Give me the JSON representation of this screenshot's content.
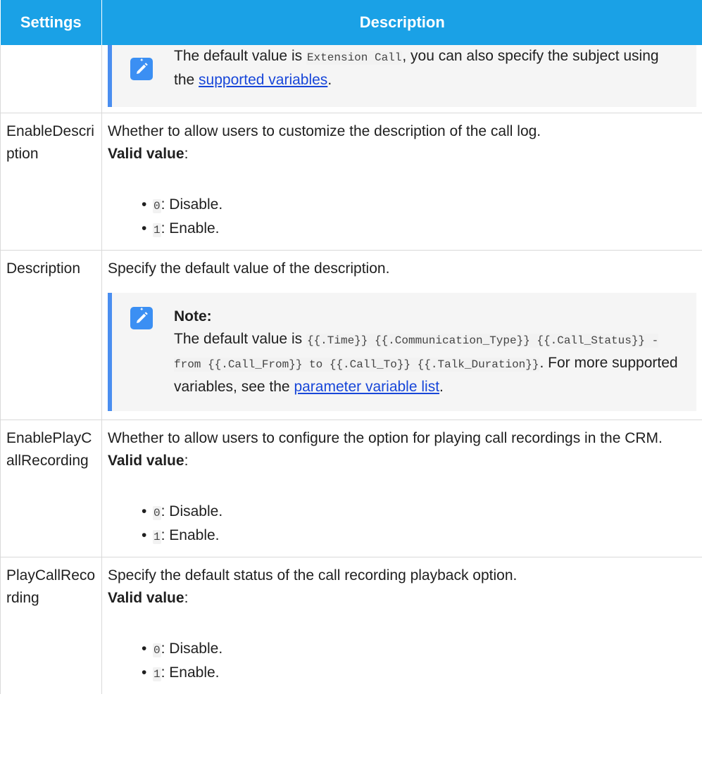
{
  "table": {
    "headers": {
      "settings": "Settings",
      "description": "Description"
    },
    "row0": {
      "note_text_before": "The default value is ",
      "note_code": "Extension Call",
      "note_text_mid": ", you can also specify the subject using the ",
      "note_link": "supported variables",
      "note_text_after": "."
    },
    "row1": {
      "setting": "EnableDescription",
      "desc": "Whether to allow users to customize the description of the call log.",
      "valid_label": "Valid value",
      "valid_colon": ":",
      "items": [
        {
          "code": "0",
          "text": ": Disable."
        },
        {
          "code": "1",
          "text": ": Enable."
        }
      ]
    },
    "row2": {
      "setting": "Description",
      "desc": "Specify the default value of the description.",
      "note_title": "Note:",
      "note_text_before": "The default value is ",
      "note_code": "{{.Time}} {{.Communication_Type}} {{.Call_Status}} - from {{.Call_From}} to {{.Call_To}} {{.Talk_Duration}}",
      "note_text_mid": ". For more supported variables, see the ",
      "note_link": "parameter variable list",
      "note_text_after": "."
    },
    "row3": {
      "setting": "EnablePlayCallRecording",
      "desc": "Whether to allow users to configure the option for playing call recordings in the CRM.",
      "valid_label": "Valid value",
      "valid_colon": ":",
      "items": [
        {
          "code": "0",
          "text": ": Disable."
        },
        {
          "code": "1",
          "text": ": Enable."
        }
      ]
    },
    "row4": {
      "setting": "PlayCallRecording",
      "desc": "Specify the default status of the call recording playback option.",
      "valid_label": "Valid value",
      "valid_colon": ":",
      "items": [
        {
          "code": "0",
          "text": ": Disable."
        },
        {
          "code": "1",
          "text": ": Enable."
        }
      ]
    }
  },
  "icons": {
    "note": "pencil-note-icon"
  },
  "colors": {
    "header_bg": "#1aa1e6",
    "note_bar": "#4a8ef0",
    "note_icon": "#3b8ff3",
    "link": "#1746d9"
  }
}
